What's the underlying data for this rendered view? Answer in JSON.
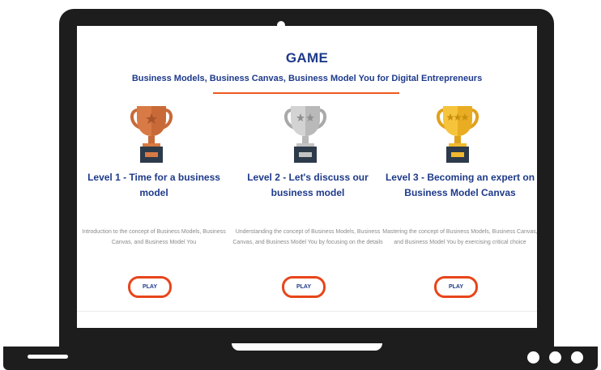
{
  "game": {
    "title": "GAME",
    "subtitle": "Business Models, Business Canvas, Business Model You for Digital Entrepreneurs"
  },
  "levels": [
    {
      "title": "Level 1 - Time for a business model",
      "description": "Introduction to the concept of Business Models, Business Canvas, and Business Model You",
      "button": "PLAY",
      "trophy_icon": "bronze-trophy-icon",
      "trophy_color": "#d87a45"
    },
    {
      "title": "Level 2 - Let's discuss our business model",
      "description": "Understanding the concept of Business Models, Business Canvas, and Business Model You by focusing on the details",
      "button": "PLAY",
      "trophy_icon": "silver-trophy-icon",
      "trophy_color": "#c3c3c3"
    },
    {
      "title": "Level 3 - Becoming an expert on Business Model Canvas",
      "description": "Mastering the concept of Business Models, Business Canvas, and Business Model You by exercising critical choice",
      "button": "PLAY",
      "trophy_icon": "gold-trophy-icon",
      "trophy_color": "#f1b92e"
    }
  ],
  "colors": {
    "accent_blue": "#1e3a8a",
    "accent_orange": "#e8451a",
    "laptop": "#1d1d1d"
  }
}
